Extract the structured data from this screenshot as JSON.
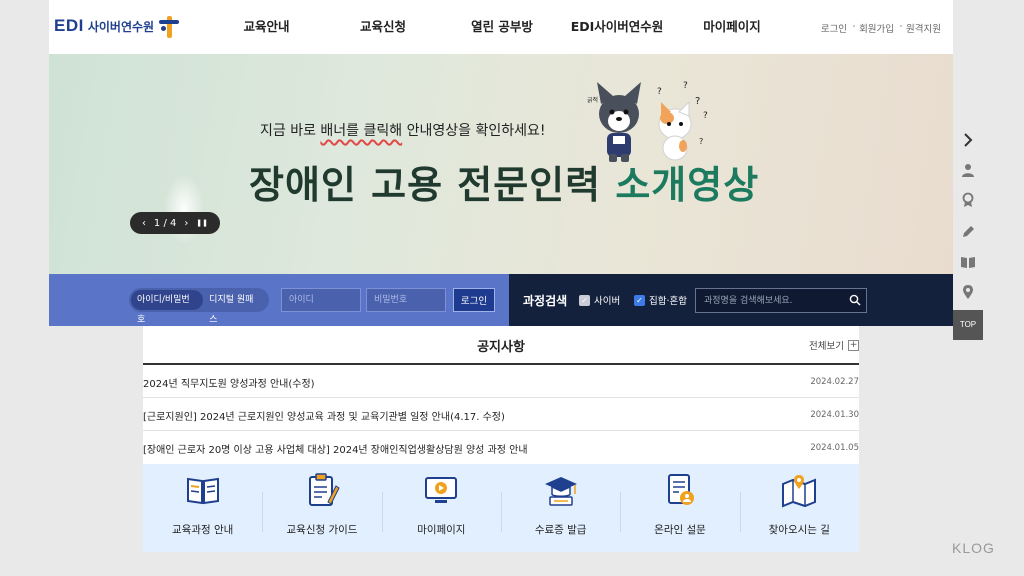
{
  "header": {
    "logo_text": "EDI",
    "logo_sub": "사이버연수원",
    "nav": [
      "교육안내",
      "교육신청",
      "열린 공부방",
      "EDI사이버연수원",
      "마이페이지"
    ],
    "util": [
      "로그인",
      "회원가입",
      "원격지원"
    ]
  },
  "banner": {
    "sub_pre": "지금 바로 ",
    "sub_highlight": "배너를 클릭해",
    "sub_post": " 안내영상을 확인하세요!",
    "title_main": "장애인 고용 전문인력 ",
    "title_accent": "소개영상",
    "pager_prev": "‹",
    "pager_text": "1 / 4",
    "pager_next": "›",
    "pager_pause": "❚❚",
    "mascot_text": "긁적",
    "colors": {
      "title": "#213a2f",
      "accent": "#1c7a5e",
      "underline": "#e04848"
    }
  },
  "login": {
    "tabs": [
      "아이디/비밀번호",
      "디지털 원패스"
    ],
    "id_placeholder": "아이디",
    "pw_placeholder": "비밀번호",
    "button": "로그인"
  },
  "course_search": {
    "label": "과정검색",
    "options": [
      {
        "label": "사이버",
        "checked": false
      },
      {
        "label": "집합·혼합",
        "checked": true
      }
    ],
    "placeholder": "과정명을 검색해보세요."
  },
  "quick": {
    "top": "TOP",
    "icons": [
      "chevron-right-icon",
      "person-icon",
      "award-icon",
      "pencil-icon",
      "book-icon",
      "location-icon"
    ]
  },
  "notice": {
    "title": "공지사항",
    "more": "전체보기",
    "items": [
      {
        "title": "2024년 직무지도원 양성과정 안내(수정)",
        "date": "2024.02.27"
      },
      {
        "title": "[근로지원인] 2024년 근로지원인 양성교육 과정 및 교육기관별 일정 안내(4.17. 수정)",
        "date": "2024.01.30"
      },
      {
        "title": "[장애인 근로자 20명 이상 고용 사업체 대상] 2024년 장애인직업생활상담원 양성 과정 안내",
        "date": "2024.01.05"
      }
    ]
  },
  "menu": [
    {
      "label": "교육과정 안내",
      "icon": "book-open-icon"
    },
    {
      "label": "교육신청 가이드",
      "icon": "clipboard-icon"
    },
    {
      "label": "마이페이지",
      "icon": "monitor-play-icon"
    },
    {
      "label": "수료증 발급",
      "icon": "graduation-cap-icon"
    },
    {
      "label": "온라인 설문",
      "icon": "survey-icon"
    },
    {
      "label": "찾아오시는 길",
      "icon": "map-icon"
    }
  ],
  "watermark": "KLOG"
}
